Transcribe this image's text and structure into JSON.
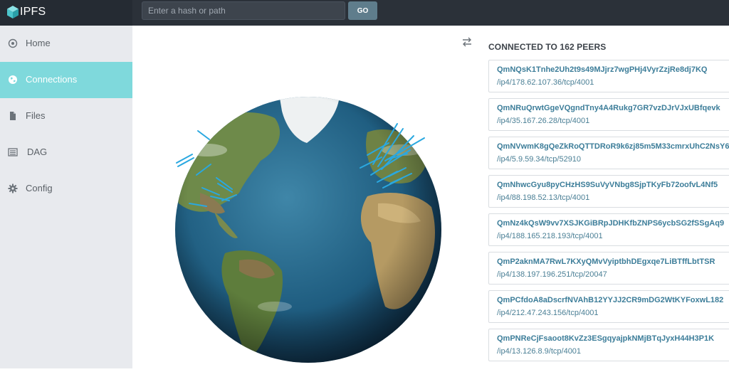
{
  "header": {
    "brand_name": "IPFS",
    "search_placeholder": "Enter a hash or path",
    "go_label": "GO"
  },
  "sidebar": {
    "items": [
      {
        "label": "Home",
        "icon": "target-icon",
        "active": false
      },
      {
        "label": "Connections",
        "icon": "globe-icon",
        "active": true
      },
      {
        "label": "Files",
        "icon": "file-icon",
        "active": false
      },
      {
        "label": "DAG",
        "icon": "list-icon",
        "active": false
      },
      {
        "label": "Config",
        "icon": "gear-icon",
        "active": false
      }
    ]
  },
  "connections": {
    "title": "CONNECTED TO 162 PEERS",
    "peers": [
      {
        "id": "QmNQsK1Tnhe2Uh2t9s49MJjrz7wgPHj4VyrZzjRe8dj7KQ",
        "address": "/ip4/178.62.107.36/tcp/4001"
      },
      {
        "id": "QmNRuQrwtGgeVQgndTny4A4Rukg7GR7vzDJrVJxUBfqevk",
        "address": "/ip4/35.167.26.28/tcp/4001"
      },
      {
        "id": "QmNVwmK8gQeZkRoQTTDRoR9k6zj85m5M33cmrxUhC2NsY6",
        "address": "/ip4/5.9.59.34/tcp/52910"
      },
      {
        "id": "QmNhwcGyu8pyCHzHS9SuVyVNbg8SjpTKyFb72oofvL4Nf5",
        "address": "/ip4/88.198.52.13/tcp/4001"
      },
      {
        "id": "QmNz4kQsW9vv7XSJKGiBRpJDHKfbZNPS6ycbSG2fSSgAq9",
        "address": "/ip4/188.165.218.193/tcp/4001"
      },
      {
        "id": "QmP2aknMA7RwL7KXyQMvVyiptbhDEgxqe7LiBTffLbtTSR",
        "address": "/ip4/138.197.196.251/tcp/20047"
      },
      {
        "id": "QmPCfdoA8aDscrfNVAhB12YYJJ2CR9mDG2WtKYFoxwL182",
        "address": "/ip4/212.47.243.156/tcp/4001"
      },
      {
        "id": "QmPNReCjFsaoot8KvZz3ESgqyajpkNMjBTqJyxH44H3P1K",
        "address": "/ip4/13.126.8.9/tcp/4001"
      }
    ]
  },
  "colors": {
    "topbar": "#2b3139",
    "sidebar": "#e8eaee",
    "active_nav": "#7fd9dc",
    "peer_text": "#3c7d99",
    "connection_lines": "#2aa8e0"
  }
}
